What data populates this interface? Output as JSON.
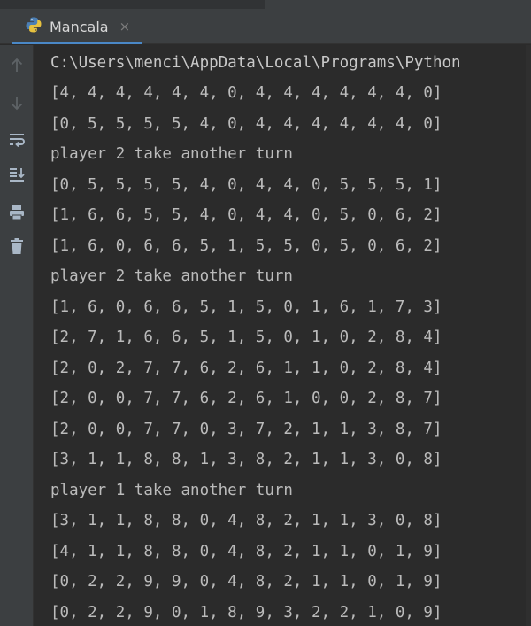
{
  "window": {
    "tab_title": "Mancala",
    "tab_close": "×",
    "accent": "#4a88c7"
  },
  "toolbar": {
    "icons": [
      "up-arrow-icon",
      "down-arrow-icon",
      "soft-wrap-icon",
      "scroll-to-end-icon",
      "print-icon",
      "trash-icon"
    ]
  },
  "console": {
    "lines": [
      "C:\\Users\\menci\\AppData\\Local\\Programs\\Python",
      "[4, 4, 4, 4, 4, 4, 0, 4, 4, 4, 4, 4, 4, 0]",
      "[0, 5, 5, 5, 5, 4, 0, 4, 4, 4, 4, 4, 4, 0]",
      "player 2 take another turn",
      "[0, 5, 5, 5, 5, 4, 0, 4, 4, 0, 5, 5, 5, 1]",
      "[1, 6, 6, 5, 5, 4, 0, 4, 4, 0, 5, 0, 6, 2]",
      "[1, 6, 0, 6, 6, 5, 1, 5, 5, 0, 5, 0, 6, 2]",
      "player 2 take another turn",
      "[1, 6, 0, 6, 6, 5, 1, 5, 0, 1, 6, 1, 7, 3]",
      "[2, 7, 1, 6, 6, 5, 1, 5, 0, 1, 0, 2, 8, 4]",
      "[2, 0, 2, 7, 7, 6, 2, 6, 1, 1, 0, 2, 8, 4]",
      "[2, 0, 0, 7, 7, 6, 2, 6, 1, 0, 0, 2, 8, 7]",
      "[2, 0, 0, 7, 7, 0, 3, 7, 2, 1, 1, 3, 8, 7]",
      "[3, 1, 1, 8, 8, 1, 3, 8, 2, 1, 1, 3, 0, 8]",
      "player 1 take another turn",
      "[3, 1, 1, 8, 8, 0, 4, 8, 2, 1, 1, 3, 0, 8]",
      "[4, 1, 1, 8, 8, 0, 4, 8, 2, 1, 1, 0, 1, 9]",
      "[0, 2, 2, 9, 9, 0, 4, 8, 2, 1, 1, 0, 1, 9]",
      "[0, 2, 2, 9, 0, 1, 8, 9, 3, 2, 2, 1, 0, 9]"
    ]
  }
}
